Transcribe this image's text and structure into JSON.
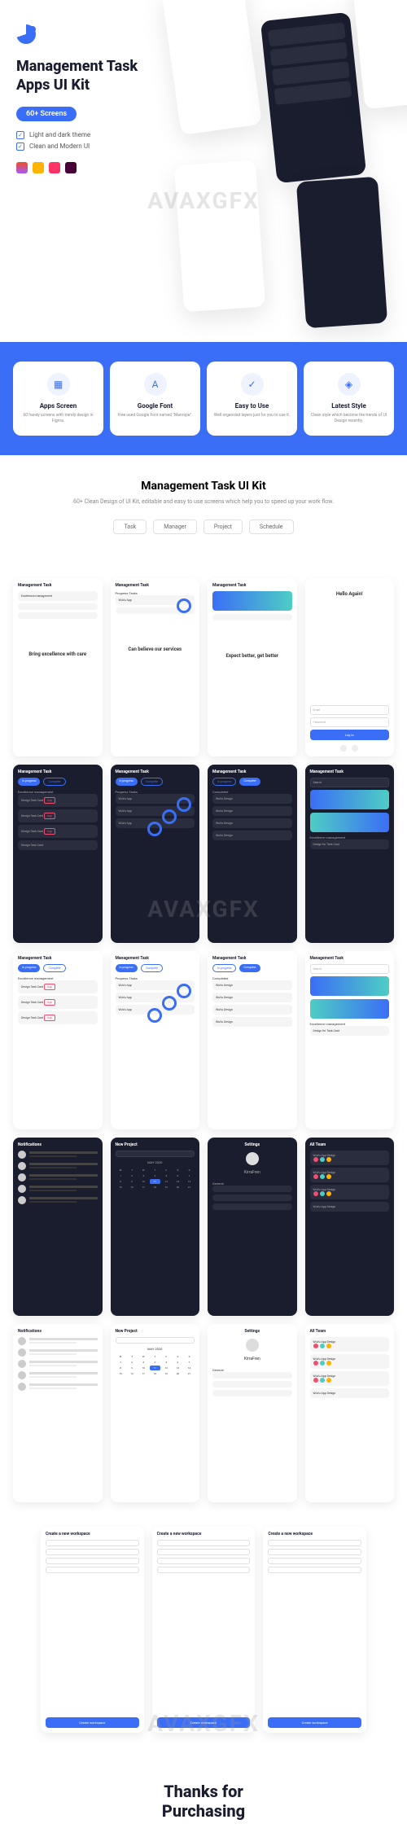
{
  "watermark": "AVAXGFX",
  "hero": {
    "title_line1": "Management Task",
    "title_line2": "Apps UI Kit",
    "screens_badge": "60+ Screens",
    "feat1": "Light and dark theme",
    "feat2": "Clean and Modern UI"
  },
  "features": [
    {
      "title": "Apps Screen",
      "desc": "60 handy screens with trendy design in Figma."
    },
    {
      "title": "Google Font",
      "desc": "Free used Google Font named \"Manrope\"."
    },
    {
      "title": "Easy to Use",
      "desc": "Well organized layers just for you to use it."
    },
    {
      "title": "Latest Style",
      "desc": "Clean style which become the trends of UI Design recently."
    }
  ],
  "kit": {
    "title": "Management Task UI Kit",
    "subtitle": "60+ Clean Design of UI Kit, editable and easy to use screens which help you to speed up your work flow.",
    "tags": [
      "Task",
      "Manager",
      "Project",
      "Schedule"
    ]
  },
  "splash": [
    "Bring excellence with care",
    "Can believe our services",
    "Expect better, get better"
  ],
  "login": {
    "title": "Hello Again!"
  },
  "screen_labels": {
    "management_task": "Management Task",
    "excellence": "Excellence management",
    "design_card": "Design Task Card",
    "progress": "Progress Tasks",
    "wuvu": "WuVu App",
    "wuvu_design": "WuVu Design",
    "wuvu_app_design": "WuVu App Design",
    "completed": "Completed",
    "search": "Search",
    "design_for": "Design for Task Card",
    "notification": "Notifications",
    "new_project": "New Project",
    "may": "MAY 2020",
    "settings": "Settings",
    "kirrafren": "KirraFren",
    "general": "General",
    "all_team": "All Team",
    "workspace_title": "Create a new workspace",
    "workspace_btn": "Create workspace"
  },
  "thanks": {
    "line1": "Thanks for",
    "line2": "Purchasing"
  }
}
